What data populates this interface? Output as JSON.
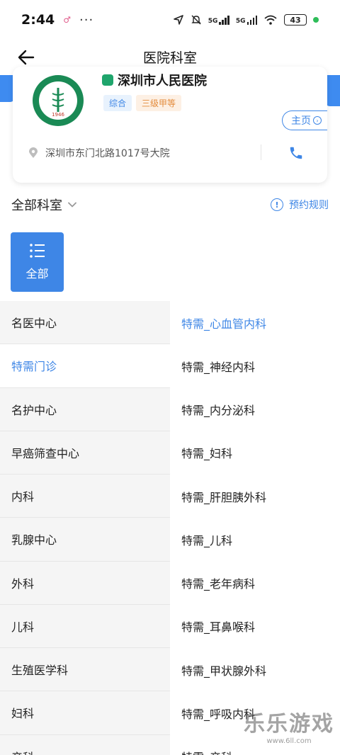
{
  "status_bar": {
    "time": "2:44",
    "notif": "♂",
    "dots": "···",
    "net1": "5G",
    "net2": "5G",
    "battery": "43"
  },
  "header": {
    "title": "医院科室"
  },
  "hospital": {
    "name": "深圳市人民医院",
    "tags": [
      "综合",
      "三级甲等"
    ],
    "home_label": "主页",
    "address": "深圳市东门北路1017号大院",
    "logo_year": "1946"
  },
  "filter": {
    "label": "全部科室",
    "rules_label": "预约规则"
  },
  "all_button": {
    "label": "全部"
  },
  "left_categories": [
    "名医中心",
    "特需门诊",
    "名护中心",
    "早癌筛查中心",
    "内科",
    "乳腺中心",
    "外科",
    "儿科",
    "生殖医学科",
    "妇科",
    "产科"
  ],
  "right_departments": [
    "特需_心血管内科",
    "特需_神经内科",
    "特需_内分泌科",
    "特需_妇科",
    "特需_肝胆胰外科",
    "特需_儿科",
    "特需_老年病科",
    "特需_耳鼻喉科",
    "特需_甲状腺外科",
    "特需_呼吸内科",
    "特需_产科"
  ],
  "watermark": {
    "brand": "乐乐游戏",
    "url": "www.6ll.com"
  },
  "colors": {
    "accent": "#3e86e6",
    "tag_orange": "#e38b3c",
    "logo_green": "#1a8a55"
  }
}
